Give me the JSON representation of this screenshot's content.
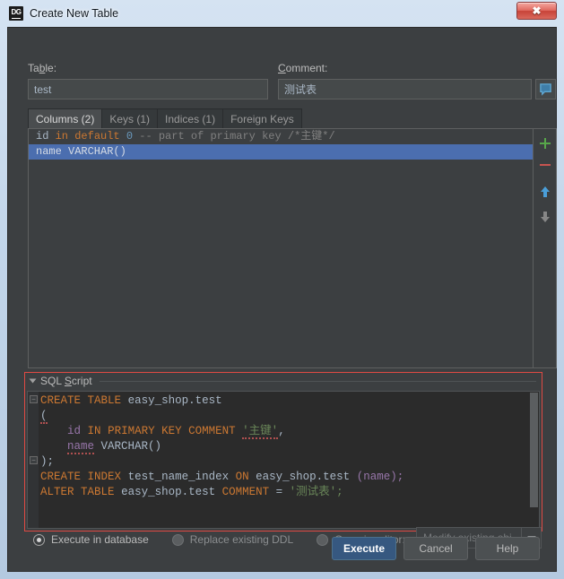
{
  "window": {
    "title": "Create New Table",
    "app_icon": "datagrip-dg-icon",
    "close_label": "✖"
  },
  "form": {
    "table_label_pre": "Ta",
    "table_label_mn": "b",
    "table_label_post": "le:",
    "table_value": "test",
    "comment_label_mn": "C",
    "comment_label_post": "omment:",
    "comment_value": "测试表",
    "comment_icon": "speech-bubble-icon"
  },
  "tabs": [
    {
      "label": "Columns (2)",
      "active": true
    },
    {
      "label": "Keys (1)",
      "active": false
    },
    {
      "label": "Indices (1)",
      "active": false
    },
    {
      "label": "Foreign Keys",
      "active": false
    }
  ],
  "columns": {
    "row1": {
      "name": "id",
      "kw_in": "in",
      "kw_default": "default",
      "value": "0",
      "comment": "-- part of primary key /*主键*/"
    },
    "row2": {
      "text": "name VARCHAR()",
      "selected": true
    }
  },
  "side_tools": [
    {
      "icon": "plus-icon",
      "color": "#57a64a"
    },
    {
      "icon": "minus-icon",
      "color": "#c75450"
    },
    {
      "icon": "arrow-up-icon",
      "color": "#4a9ed8"
    },
    {
      "icon": "arrow-down-icon",
      "color": "#878787"
    }
  ],
  "sql_panel": {
    "title_pre": "SQL ",
    "title_mn": "S",
    "title_post": "cript",
    "border_color": "#e04a44",
    "lines": [
      "CREATE TABLE easy_shop.test",
      "(",
      "    id IN PRIMARY KEY COMMENT '主键',",
      "    name VARCHAR()",
      ");",
      "CREATE INDEX test_name_index ON easy_shop.test (name);",
      "ALTER TABLE easy_shop.test COMMENT = '测试表';"
    ],
    "tok": {
      "create": "CREATE",
      "table": "TABLE",
      "easy_shop_test": "easy_shop.test",
      "paren_open": "(",
      "id": "id",
      "in": "IN",
      "primary": "PRIMARY",
      "key": "KEY",
      "comment": "COMMENT",
      "str_zhujian": "'主键'",
      "comma": ",",
      "name": "name",
      "varchar": "VARCHAR()",
      "paren_close_semi": ");",
      "index": "INDEX",
      "test_name_index": "test_name_index",
      "on": "ON",
      "name_paren": "(name);",
      "alter": "ALTER",
      "equals": "=",
      "str_ceshibiao": "'测试表';"
    }
  },
  "options": {
    "execute_in_database": "Execute in database",
    "replace_existing_ddl": "Replace existing DDL",
    "open_in_editor": "Open in editor:",
    "combo_value": "Modify existing obj…"
  },
  "buttons": {
    "execute": "Execute",
    "cancel": "Cancel",
    "help": "Help"
  }
}
